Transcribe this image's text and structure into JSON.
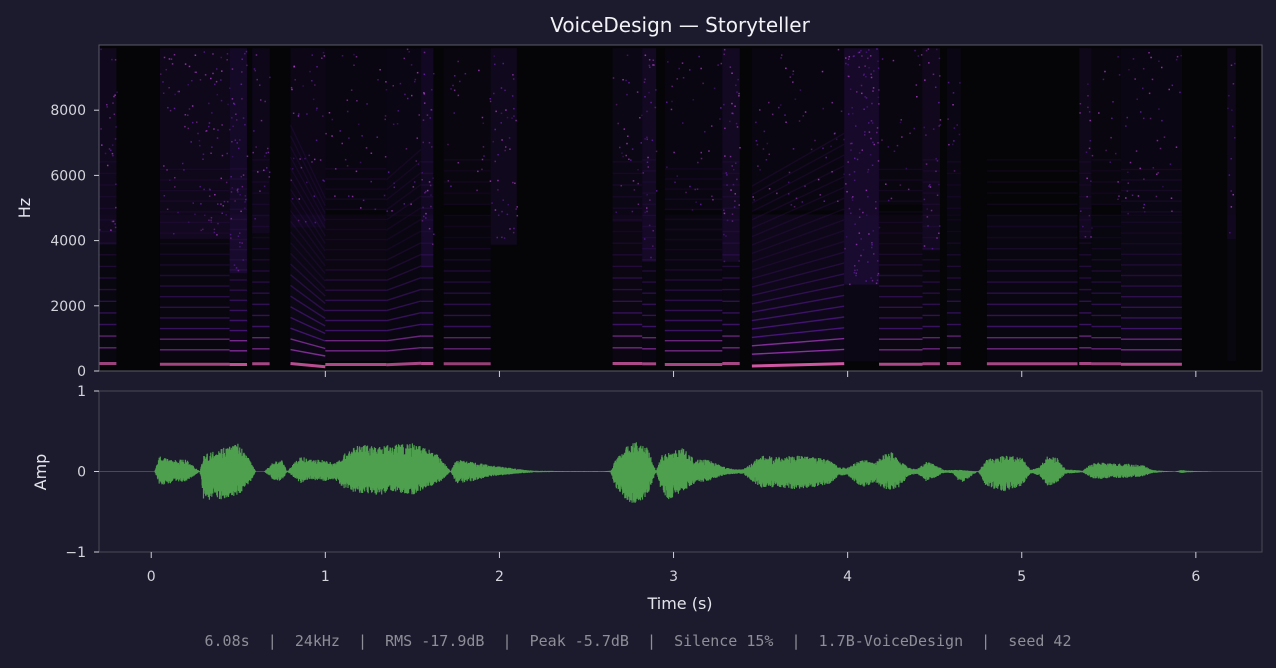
{
  "chart_data": [
    {
      "type": "heatmap",
      "title": "VoiceDesign — Storyteller",
      "ylabel": "Hz",
      "xlim": [
        -0.3,
        6.38
      ],
      "ylim": [
        0,
        10000
      ],
      "yticks": [
        0,
        2000,
        4000,
        6000,
        8000
      ],
      "xticks": [
        1,
        2,
        3,
        4,
        5,
        6
      ],
      "colormap": [
        "#050508",
        "#2a0f4d",
        "#6a1fb3",
        "#b43fd0",
        "#ff6ac8"
      ],
      "segments": [
        {
          "start": -0.3,
          "end": -0.2,
          "f0": 230,
          "high": 0.55,
          "mid": 0.3,
          "tilt": 0
        },
        {
          "start": 0.05,
          "end": 0.45,
          "f0": 210,
          "high": 0.5,
          "mid": 0.35,
          "tilt": 0
        },
        {
          "start": 0.45,
          "end": 0.55,
          "f0": 200,
          "high": 0.8,
          "mid": 0.6,
          "tilt": 0
        },
        {
          "start": 0.58,
          "end": 0.68,
          "f0": 220,
          "high": 0.45,
          "mid": 0.4,
          "tilt": 0
        },
        {
          "start": 0.8,
          "end": 1.0,
          "f0": 180,
          "high": 0.4,
          "mid": 0.55,
          "tilt": -0.4
        },
        {
          "start": 1.0,
          "end": 1.35,
          "f0": 200,
          "high": 0.25,
          "mid": 0.45,
          "tilt": 0
        },
        {
          "start": 1.35,
          "end": 1.55,
          "f0": 215,
          "high": 0.3,
          "mid": 0.4,
          "tilt": 0.2
        },
        {
          "start": 1.55,
          "end": 1.62,
          "f0": 230,
          "high": 0.75,
          "mid": 0.5,
          "tilt": 0
        },
        {
          "start": 1.68,
          "end": 1.95,
          "f0": 220,
          "high": 0.2,
          "mid": 0.25,
          "tilt": 0
        },
        {
          "start": 1.95,
          "end": 2.1,
          "f0": 0,
          "high": 0.55,
          "mid": 0.1,
          "tilt": 0
        },
        {
          "start": 2.65,
          "end": 2.82,
          "f0": 230,
          "high": 0.35,
          "mid": 0.45,
          "tilt": 0
        },
        {
          "start": 2.82,
          "end": 2.9,
          "f0": 220,
          "high": 0.7,
          "mid": 0.4,
          "tilt": 0
        },
        {
          "start": 2.95,
          "end": 3.28,
          "f0": 200,
          "high": 0.25,
          "mid": 0.4,
          "tilt": 0
        },
        {
          "start": 3.28,
          "end": 3.38,
          "f0": 230,
          "high": 0.7,
          "mid": 0.4,
          "tilt": 0
        },
        {
          "start": 3.45,
          "end": 3.98,
          "f0": 190,
          "high": 0.25,
          "mid": 0.75,
          "tilt": 0.3
        },
        {
          "start": 3.98,
          "end": 4.18,
          "f0": 0,
          "high": 0.9,
          "mid": 0.5,
          "tilt": 0
        },
        {
          "start": 4.18,
          "end": 4.43,
          "f0": 210,
          "high": 0.2,
          "mid": 0.45,
          "tilt": 0
        },
        {
          "start": 4.43,
          "end": 4.53,
          "f0": 220,
          "high": 0.6,
          "mid": 0.35,
          "tilt": 0
        },
        {
          "start": 4.57,
          "end": 4.65,
          "f0": 230,
          "high": 0.3,
          "mid": 0.3,
          "tilt": 0
        },
        {
          "start": 4.8,
          "end": 5.32,
          "f0": 220,
          "high": 0.15,
          "mid": 0.4,
          "tilt": 0
        },
        {
          "start": 5.33,
          "end": 5.4,
          "f0": 230,
          "high": 0.5,
          "mid": 0.4,
          "tilt": 0
        },
        {
          "start": 5.4,
          "end": 5.57,
          "f0": 220,
          "high": 0.2,
          "mid": 0.3,
          "tilt": 0
        },
        {
          "start": 5.57,
          "end": 5.92,
          "f0": 210,
          "high": 0.3,
          "mid": 0.5,
          "tilt": 0
        },
        {
          "start": 6.18,
          "end": 6.23,
          "f0": 0,
          "high": 0.5,
          "mid": 0.3,
          "tilt": 0
        }
      ]
    },
    {
      "type": "area",
      "xlabel": "Time (s)",
      "ylabel": "Amp",
      "xlim": [
        -0.3,
        6.38
      ],
      "ylim": [
        -1,
        1
      ],
      "yticks": [
        -1,
        0,
        1
      ],
      "ytick_labels": [
        "−1",
        "0",
        "1"
      ],
      "xticks": [
        0,
        1,
        2,
        3,
        4,
        5,
        6
      ],
      "color": "#4e9f4e",
      "envelope": {
        "t": [
          0.02,
          0.05,
          0.1,
          0.2,
          0.28,
          0.3,
          0.4,
          0.5,
          0.58,
          0.6,
          0.65,
          0.7,
          0.75,
          0.78,
          0.86,
          0.9,
          1.0,
          1.05,
          1.1,
          1.15,
          1.25,
          1.3,
          1.4,
          1.5,
          1.58,
          1.65,
          1.72,
          1.75,
          1.85,
          1.95,
          2.05,
          2.15,
          2.2,
          2.4,
          2.6,
          2.64,
          2.66,
          2.72,
          2.78,
          2.85,
          2.9,
          2.93,
          2.97,
          3.05,
          3.12,
          3.2,
          3.3,
          3.36,
          3.4,
          3.45,
          3.5,
          3.6,
          3.7,
          3.8,
          3.9,
          3.95,
          4.0,
          4.05,
          4.1,
          4.15,
          4.2,
          4.25,
          4.3,
          4.35,
          4.4,
          4.45,
          4.5,
          4.55,
          4.6,
          4.65,
          4.75,
          4.8,
          4.9,
          5.0,
          5.05,
          5.1,
          5.15,
          5.2,
          5.25,
          5.3,
          5.35,
          5.4,
          5.45,
          5.5,
          5.6,
          5.7,
          5.75,
          5.8,
          5.88,
          5.92,
          5.95,
          6.1
        ],
        "pos": [
          0,
          0.2,
          0.15,
          0.15,
          0,
          0.2,
          0.3,
          0.35,
          0.1,
          0,
          0,
          0.12,
          0.15,
          0,
          0.2,
          0.15,
          0.15,
          0.1,
          0.2,
          0.3,
          0.35,
          0.3,
          0.35,
          0.35,
          0.3,
          0.2,
          0,
          0.15,
          0.12,
          0.08,
          0.05,
          0.02,
          0.01,
          0.005,
          0.005,
          0.01,
          0.12,
          0.3,
          0.38,
          0.3,
          0,
          0.2,
          0.25,
          0.3,
          0.15,
          0.15,
          0.05,
          0.03,
          0.03,
          0.1,
          0.2,
          0.18,
          0.2,
          0.18,
          0.15,
          0.05,
          0.05,
          0.12,
          0.15,
          0.1,
          0.2,
          0.25,
          0.15,
          0.05,
          0.03,
          0.12,
          0.1,
          0.02,
          0.02,
          0.02,
          0,
          0.15,
          0.2,
          0.18,
          0.02,
          0.05,
          0.2,
          0.18,
          0.03,
          0.02,
          0.01,
          0.1,
          0.12,
          0.1,
          0.1,
          0.08,
          0.02,
          0.01,
          0,
          0.02,
          0.01,
          0
        ],
        "neg": [
          0,
          0.18,
          0.15,
          0.12,
          0,
          0.35,
          0.35,
          0.3,
          0.1,
          0,
          0,
          0.1,
          0.12,
          0,
          0.15,
          0.1,
          0.12,
          0.1,
          0.2,
          0.25,
          0.28,
          0.3,
          0.25,
          0.3,
          0.2,
          0.15,
          0,
          0.15,
          0.12,
          0.06,
          0.04,
          0.02,
          0.01,
          0.005,
          0.005,
          0.01,
          0.18,
          0.35,
          0.45,
          0.3,
          0,
          0.25,
          0.35,
          0.25,
          0.15,
          0.12,
          0.04,
          0.03,
          0.03,
          0.12,
          0.2,
          0.2,
          0.22,
          0.2,
          0.15,
          0.05,
          0.05,
          0.15,
          0.2,
          0.15,
          0.2,
          0.25,
          0.2,
          0.05,
          0.03,
          0.12,
          0.08,
          0.02,
          0.02,
          0.15,
          0,
          0.2,
          0.25,
          0.18,
          0.02,
          0.05,
          0.18,
          0.15,
          0.03,
          0.02,
          0.01,
          0.08,
          0.1,
          0.08,
          0.08,
          0.06,
          0.02,
          0.01,
          0,
          0.02,
          0.01,
          0
        ]
      }
    }
  ],
  "footer": {
    "duration": "6.08s",
    "sample_rate": "24kHz",
    "rms": "RMS -17.9dB",
    "peak": "Peak -5.7dB",
    "silence": "Silence 15%",
    "model": "1.7B-VoiceDesign",
    "seed": "seed 42"
  }
}
